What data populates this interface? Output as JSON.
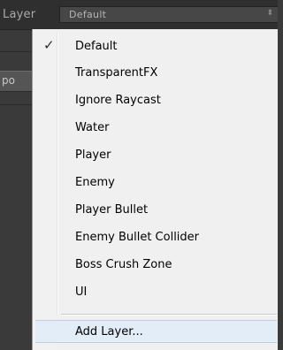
{
  "inspector": {
    "layer_label": "Layer",
    "layer_value": "Default",
    "dropdown_arrow": "⬍",
    "left_tab_text": "po"
  },
  "menu": {
    "items": [
      {
        "label": "Default",
        "checked": true
      },
      {
        "label": "TransparentFX",
        "checked": false
      },
      {
        "label": "Ignore Raycast",
        "checked": false
      },
      {
        "label": "Water",
        "checked": false
      },
      {
        "label": "Player",
        "checked": false
      },
      {
        "label": "Enemy",
        "checked": false
      },
      {
        "label": "Player Bullet",
        "checked": false
      },
      {
        "label": "Enemy Bullet Collider",
        "checked": false
      },
      {
        "label": "Boss Crush Zone",
        "checked": false
      },
      {
        "label": "UI",
        "checked": false
      }
    ],
    "add_layer_label": "Add Layer...",
    "check_glyph": "✓"
  }
}
